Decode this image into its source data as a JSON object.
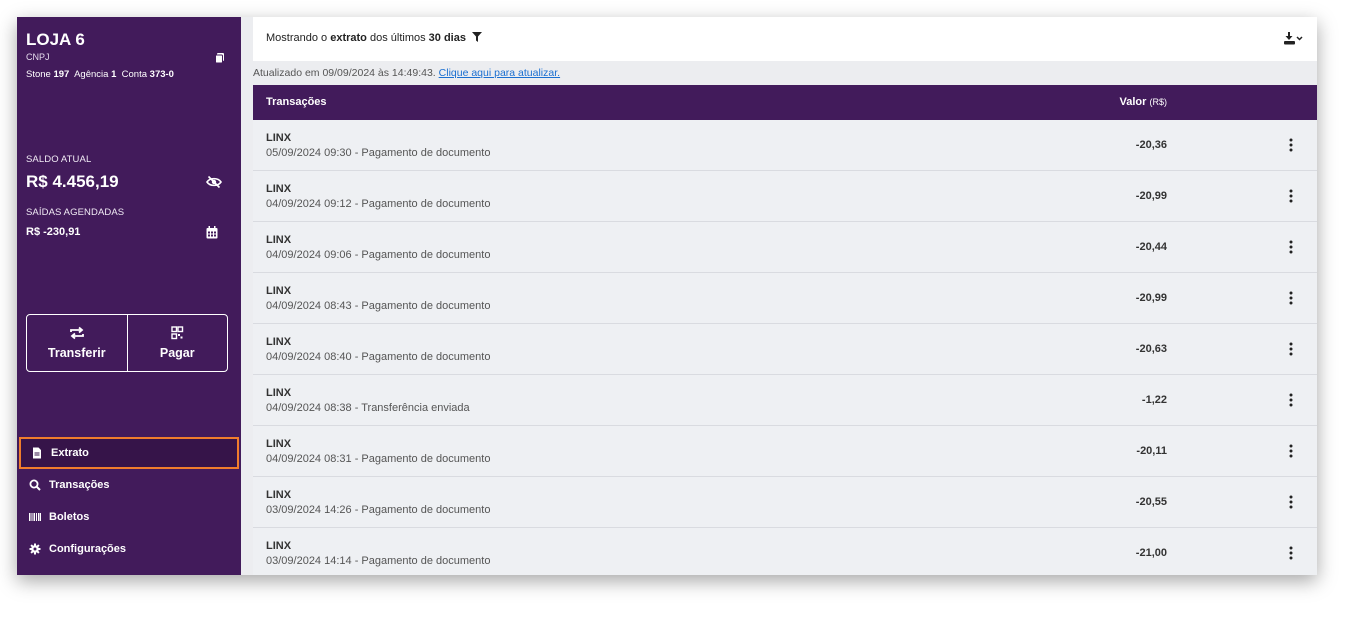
{
  "store": {
    "name": "LOJA 6",
    "cnpj_label": "CNPJ",
    "bank_label": "Stone",
    "bank_value": "197",
    "agency_label": "Agência",
    "agency_value": "1",
    "account_label": "Conta",
    "account_value": "373-0"
  },
  "balance": {
    "current_label": "SALDO ATUAL",
    "current_value": "R$ 4.456,19",
    "scheduled_label": "SAÍDAS AGENDADAS",
    "scheduled_value": "R$ -230,91"
  },
  "actions": {
    "transfer_label": "Transferir",
    "pay_label": "Pagar"
  },
  "nav": {
    "items": [
      {
        "label": "Extrato",
        "icon": "document-icon",
        "active": true
      },
      {
        "label": "Transações",
        "icon": "search-icon"
      },
      {
        "label": "Boletos",
        "icon": "barcode-icon"
      },
      {
        "label": "Configurações",
        "icon": "gear-icon"
      }
    ]
  },
  "header": {
    "prefix": "Mostrando o",
    "extrato": "extrato",
    "middle": "dos últimos",
    "period": "30 dias"
  },
  "updated": {
    "text": "Atualizado em 09/09/2024 às 14:49:43.",
    "link": "Clique aqui para atualizar."
  },
  "table": {
    "col_transactions": "Transações",
    "col_value": "Valor",
    "col_value_unit": "(R$)",
    "rows": [
      {
        "name": "LINX",
        "desc": "05/09/2024 09:30 - Pagamento de documento",
        "value": "-20,36"
      },
      {
        "name": "LINX",
        "desc": "04/09/2024 09:12 - Pagamento de documento",
        "value": "-20,99"
      },
      {
        "name": "LINX",
        "desc": "04/09/2024 09:06 - Pagamento de documento",
        "value": "-20,44"
      },
      {
        "name": "LINX",
        "desc": "04/09/2024 08:43 - Pagamento de documento",
        "value": "-20,99"
      },
      {
        "name": "LINX",
        "desc": "04/09/2024 08:40 - Pagamento de documento",
        "value": "-20,63"
      },
      {
        "name": "LINX",
        "desc": "04/09/2024 08:38 - Transferência enviada",
        "value": "-1,22"
      },
      {
        "name": "LINX",
        "desc": "04/09/2024 08:31 - Pagamento de documento",
        "value": "-20,11"
      },
      {
        "name": "LINX",
        "desc": "03/09/2024 14:26 - Pagamento de documento",
        "value": "-20,55"
      },
      {
        "name": "LINX",
        "desc": "03/09/2024 14:14 - Pagamento de documento",
        "value": "-21,00"
      }
    ]
  },
  "colors": {
    "brand_purple": "#421b5b",
    "active_outline": "#f07d2c",
    "link": "#1a6fd1"
  }
}
